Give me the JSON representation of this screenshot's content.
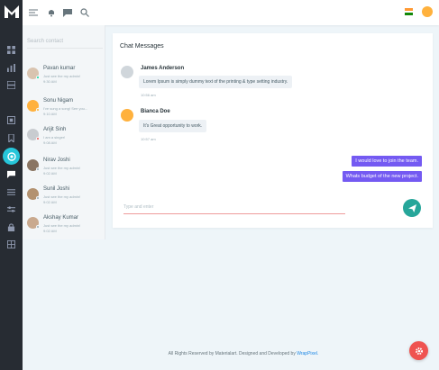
{
  "search": {
    "placeholder": "Search contact"
  },
  "contacts": [
    {
      "name": "Pavan kumar",
      "status": "Just see the my admin!",
      "time": "9:30 AM",
      "status_color": "#06d79c"
    },
    {
      "name": "Sonu Nigam",
      "status": "I've sung a song! See you...",
      "time": "9:10 AM",
      "status_color": "#ffb22b"
    },
    {
      "name": "Arijit Sinh",
      "status": "I am a singer!",
      "time": "9:08 AM",
      "status_color": "#ef5350"
    },
    {
      "name": "Nirav Joshi",
      "status": "Just see the my admin!",
      "time": "9:02 AM",
      "status_color": "#99abb4"
    },
    {
      "name": "Sunil Joshi",
      "status": "Just see the my admin!",
      "time": "9:02 AM",
      "status_color": "#99abb4"
    },
    {
      "name": "Akshay Kumar",
      "status": "Just see the my admin!",
      "time": "9:02 AM",
      "status_color": "#99abb4"
    }
  ],
  "chat": {
    "title": "Chat Messages",
    "messages": [
      {
        "sender": "James Anderson",
        "text": "Lorem Ipsum is simply dummy text of the printing & type setting industry.",
        "time": "10:56 am"
      },
      {
        "sender": "Bianca Doe",
        "text": "It's Great opportunity to work.",
        "time": "10:57 am"
      }
    ],
    "outgoing": [
      "I would love to join the team.",
      "Whats budget of the new project."
    ],
    "input_placeholder": "Type and enter"
  },
  "footer": {
    "text": "All Rights Reserved by Materialart. Designed and Developed by",
    "link": "WrapPixel."
  },
  "colors": {
    "rail": "#272c33",
    "accent": "#745af2",
    "send_button": "#26a69a",
    "settings_button": "#ef5350",
    "active_rail": "#26c6da"
  },
  "icons": {
    "logo": "logo-m-icon",
    "menu": "menu-icon",
    "notifications": "bell-icon",
    "messages": "message-icon",
    "search": "search-icon",
    "send": "send-icon",
    "settings": "gear-icon"
  }
}
